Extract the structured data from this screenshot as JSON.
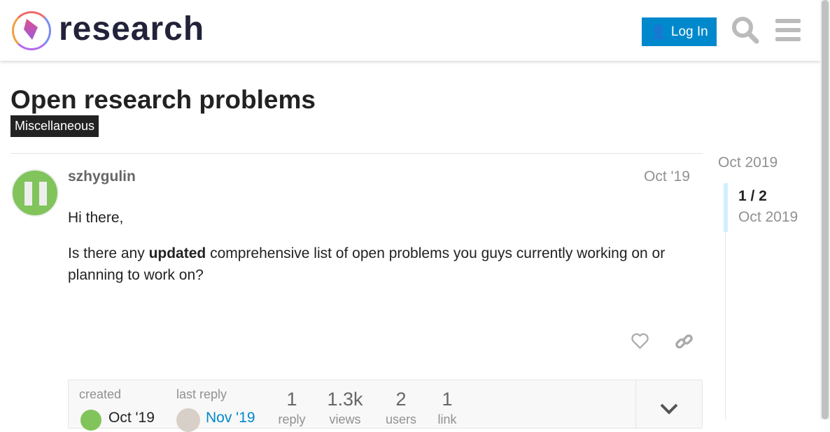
{
  "header": {
    "brand": "research",
    "login_label": "Log In",
    "icons": [
      "search-icon",
      "hamburger-menu-icon"
    ]
  },
  "topic": {
    "title": "Open research problems",
    "category": "Miscellaneous"
  },
  "post": {
    "username": "szhygulin",
    "date": "Oct '19",
    "paragraph1": "Hi there,",
    "paragraph2_pre": "Is there any ",
    "paragraph2_bold": "updated",
    "paragraph2_post": " comprehensive list of open problems you guys currently working on or planning to work on?"
  },
  "footer": {
    "created_label": "created",
    "created_date": "Oct '19",
    "last_reply_label": "last reply",
    "last_reply_date": "Nov '19",
    "stats": [
      {
        "value": "1",
        "label": "reply"
      },
      {
        "value": "1.3k",
        "label": "views"
      },
      {
        "value": "2",
        "label": "users"
      },
      {
        "value": "1",
        "label": "link"
      }
    ]
  },
  "timeline": {
    "start": "Oct 2019",
    "position": "1 / 2",
    "current_date": "Oct 2019"
  },
  "colors": {
    "accent": "#0088cc",
    "category_bg": "#222222",
    "avatar": "#81c45b"
  }
}
